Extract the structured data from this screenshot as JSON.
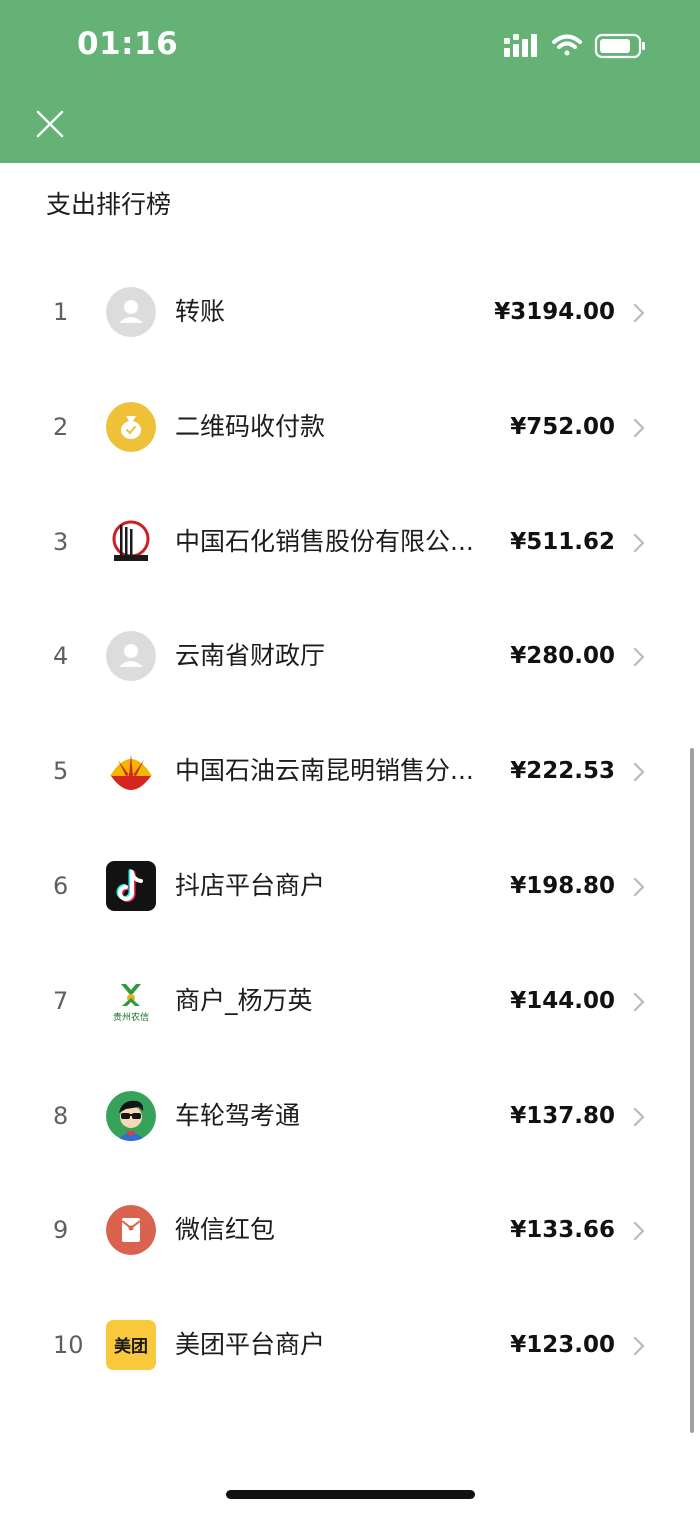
{
  "status_bar": {
    "time": "01:16"
  },
  "page": {
    "title": "支出排行榜"
  },
  "items": [
    {
      "rank": "1",
      "name": "转账",
      "amount": "¥3194.00",
      "icon": "default-avatar-icon"
    },
    {
      "rank": "2",
      "name": "二维码收付款",
      "amount": "¥752.00",
      "icon": "money-bag-icon"
    },
    {
      "rank": "3",
      "name": "中国石化销售股份有限公...",
      "amount": "¥511.62",
      "icon": "sinopec-logo"
    },
    {
      "rank": "4",
      "name": "云南省财政厅",
      "amount": "¥280.00",
      "icon": "default-avatar-icon"
    },
    {
      "rank": "5",
      "name": "中国石油云南昆明销售分...",
      "amount": "¥222.53",
      "icon": "petrochina-logo"
    },
    {
      "rank": "6",
      "name": "抖店平台商户",
      "amount": "¥198.80",
      "icon": "douyin-logo"
    },
    {
      "rank": "7",
      "name": "商户_杨万英",
      "amount": "¥144.00",
      "icon": "guizhou-rural-credit-logo",
      "logo_text": "贵州农信"
    },
    {
      "rank": "8",
      "name": "车轮驾考通",
      "amount": "¥137.80",
      "icon": "cartoon-avatar-icon"
    },
    {
      "rank": "9",
      "name": "微信红包",
      "amount": "¥133.66",
      "icon": "red-envelope-icon"
    },
    {
      "rank": "10",
      "name": "美团平台商户",
      "amount": "¥123.00",
      "icon": "meituan-logo",
      "logo_text": "美团"
    }
  ],
  "colors": {
    "header_green": "#64b276",
    "gray_avatar": "#d9d9d9",
    "gold": "#eec139",
    "red_envelope": "#d9634f",
    "meituan_yellow": "#f8c93a"
  }
}
